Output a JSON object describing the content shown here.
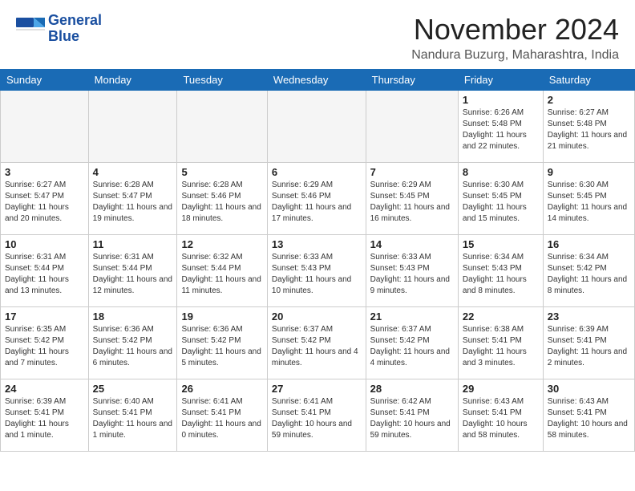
{
  "header": {
    "logo_line1": "General",
    "logo_line2": "Blue",
    "month_title": "November 2024",
    "location": "Nandura Buzurg, Maharashtra, India"
  },
  "weekdays": [
    "Sunday",
    "Monday",
    "Tuesday",
    "Wednesday",
    "Thursday",
    "Friday",
    "Saturday"
  ],
  "weeks": [
    [
      {
        "day": "",
        "empty": true
      },
      {
        "day": "",
        "empty": true
      },
      {
        "day": "",
        "empty": true
      },
      {
        "day": "",
        "empty": true
      },
      {
        "day": "",
        "empty": true
      },
      {
        "day": "1",
        "info": "Sunrise: 6:26 AM\nSunset: 5:48 PM\nDaylight: 11 hours and 22 minutes."
      },
      {
        "day": "2",
        "info": "Sunrise: 6:27 AM\nSunset: 5:48 PM\nDaylight: 11 hours and 21 minutes."
      }
    ],
    [
      {
        "day": "3",
        "info": "Sunrise: 6:27 AM\nSunset: 5:47 PM\nDaylight: 11 hours and 20 minutes."
      },
      {
        "day": "4",
        "info": "Sunrise: 6:28 AM\nSunset: 5:47 PM\nDaylight: 11 hours and 19 minutes."
      },
      {
        "day": "5",
        "info": "Sunrise: 6:28 AM\nSunset: 5:46 PM\nDaylight: 11 hours and 18 minutes."
      },
      {
        "day": "6",
        "info": "Sunrise: 6:29 AM\nSunset: 5:46 PM\nDaylight: 11 hours and 17 minutes."
      },
      {
        "day": "7",
        "info": "Sunrise: 6:29 AM\nSunset: 5:45 PM\nDaylight: 11 hours and 16 minutes."
      },
      {
        "day": "8",
        "info": "Sunrise: 6:30 AM\nSunset: 5:45 PM\nDaylight: 11 hours and 15 minutes."
      },
      {
        "day": "9",
        "info": "Sunrise: 6:30 AM\nSunset: 5:45 PM\nDaylight: 11 hours and 14 minutes."
      }
    ],
    [
      {
        "day": "10",
        "info": "Sunrise: 6:31 AM\nSunset: 5:44 PM\nDaylight: 11 hours and 13 minutes."
      },
      {
        "day": "11",
        "info": "Sunrise: 6:31 AM\nSunset: 5:44 PM\nDaylight: 11 hours and 12 minutes."
      },
      {
        "day": "12",
        "info": "Sunrise: 6:32 AM\nSunset: 5:44 PM\nDaylight: 11 hours and 11 minutes."
      },
      {
        "day": "13",
        "info": "Sunrise: 6:33 AM\nSunset: 5:43 PM\nDaylight: 11 hours and 10 minutes."
      },
      {
        "day": "14",
        "info": "Sunrise: 6:33 AM\nSunset: 5:43 PM\nDaylight: 11 hours and 9 minutes."
      },
      {
        "day": "15",
        "info": "Sunrise: 6:34 AM\nSunset: 5:43 PM\nDaylight: 11 hours and 8 minutes."
      },
      {
        "day": "16",
        "info": "Sunrise: 6:34 AM\nSunset: 5:42 PM\nDaylight: 11 hours and 8 minutes."
      }
    ],
    [
      {
        "day": "17",
        "info": "Sunrise: 6:35 AM\nSunset: 5:42 PM\nDaylight: 11 hours and 7 minutes."
      },
      {
        "day": "18",
        "info": "Sunrise: 6:36 AM\nSunset: 5:42 PM\nDaylight: 11 hours and 6 minutes."
      },
      {
        "day": "19",
        "info": "Sunrise: 6:36 AM\nSunset: 5:42 PM\nDaylight: 11 hours and 5 minutes."
      },
      {
        "day": "20",
        "info": "Sunrise: 6:37 AM\nSunset: 5:42 PM\nDaylight: 11 hours and 4 minutes."
      },
      {
        "day": "21",
        "info": "Sunrise: 6:37 AM\nSunset: 5:42 PM\nDaylight: 11 hours and 4 minutes."
      },
      {
        "day": "22",
        "info": "Sunrise: 6:38 AM\nSunset: 5:41 PM\nDaylight: 11 hours and 3 minutes."
      },
      {
        "day": "23",
        "info": "Sunrise: 6:39 AM\nSunset: 5:41 PM\nDaylight: 11 hours and 2 minutes."
      }
    ],
    [
      {
        "day": "24",
        "info": "Sunrise: 6:39 AM\nSunset: 5:41 PM\nDaylight: 11 hours and 1 minute."
      },
      {
        "day": "25",
        "info": "Sunrise: 6:40 AM\nSunset: 5:41 PM\nDaylight: 11 hours and 1 minute."
      },
      {
        "day": "26",
        "info": "Sunrise: 6:41 AM\nSunset: 5:41 PM\nDaylight: 11 hours and 0 minutes."
      },
      {
        "day": "27",
        "info": "Sunrise: 6:41 AM\nSunset: 5:41 PM\nDaylight: 10 hours and 59 minutes."
      },
      {
        "day": "28",
        "info": "Sunrise: 6:42 AM\nSunset: 5:41 PM\nDaylight: 10 hours and 59 minutes."
      },
      {
        "day": "29",
        "info": "Sunrise: 6:43 AM\nSunset: 5:41 PM\nDaylight: 10 hours and 58 minutes."
      },
      {
        "day": "30",
        "info": "Sunrise: 6:43 AM\nSunset: 5:41 PM\nDaylight: 10 hours and 58 minutes."
      }
    ]
  ]
}
